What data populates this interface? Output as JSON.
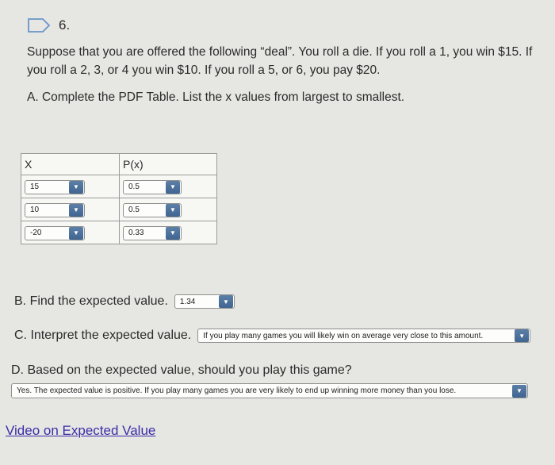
{
  "question": {
    "number": "6."
  },
  "prompt": "Suppose that you are offered the following “deal”. You roll a die. If you roll a 1, you win $15. If you roll a 2, 3, or 4 you win $10. If you roll a 5, or 6, you pay $20.",
  "partA": {
    "label": "A. Complete the PDF Table. List the x values from largest to smallest.",
    "headers": [
      "X",
      "P(x)"
    ],
    "rows": [
      {
        "x": "15",
        "p": "0.5"
      },
      {
        "x": "10",
        "p": "0.5"
      },
      {
        "x": "-20",
        "p": "0.33"
      }
    ]
  },
  "partB": {
    "label": "B. Find the expected value.",
    "value": "1.34"
  },
  "partC": {
    "label": "C. Interpret the expected value.",
    "value": "If you play many games you will likely win on average very close to this amount."
  },
  "partD": {
    "label": "D. Based on the expected value, should you play this game?",
    "value": "Yes. The expected value is positive. If you play many games you are very likely to end up winning more money than you lose."
  },
  "video_link": "Video on Expected Value",
  "colors": {
    "link": "#3b2ea8",
    "dropdown_arrow": "#4a6f9c",
    "question_icon": "#6a95c9"
  }
}
